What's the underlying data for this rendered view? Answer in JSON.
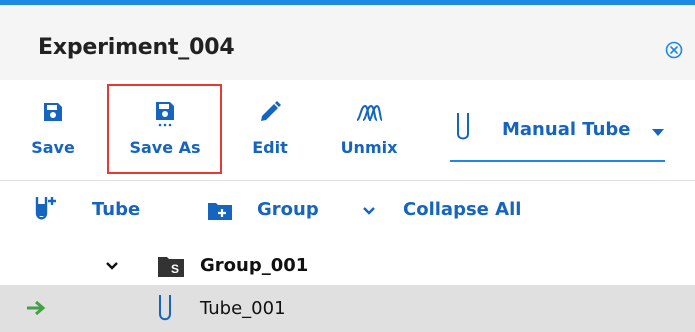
{
  "header": {
    "title": "Experiment_004"
  },
  "toolbar": {
    "save_label": "Save",
    "save_as_label": "Save As",
    "edit_label": "Edit",
    "unmix_label": "Unmix",
    "tube_type_value": "Manual Tube"
  },
  "actions": {
    "tube_label": "Tube",
    "group_label": "Group",
    "collapse_all_label": "Collapse All"
  },
  "tree": {
    "group": {
      "name": "Group_001",
      "badge": "S"
    },
    "tube": {
      "name": "Tube_001"
    }
  },
  "colors": {
    "accent": "#1565c0",
    "highlight": "#e53935",
    "selected_row": "#e0e0e0",
    "arrow": "#43a047"
  },
  "icons": [
    "close-icon",
    "save-icon",
    "save-as-icon",
    "edit-icon",
    "unmix-icon",
    "tube-icon",
    "chevron-down-icon",
    "add-tube-icon",
    "add-group-icon",
    "folder-icon",
    "arrow-right-icon"
  ]
}
